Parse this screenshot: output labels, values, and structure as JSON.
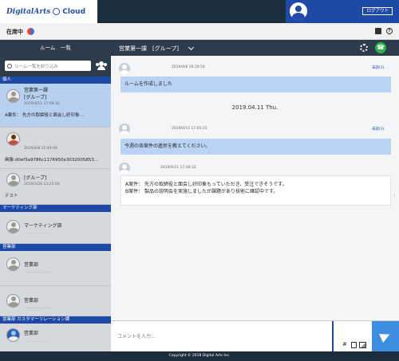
{
  "brand": {
    "name": "DigitalArts",
    "suffix": "Cloud"
  },
  "header": {
    "logout_label": "ログアウト"
  },
  "status": {
    "label": "在席中"
  },
  "sidebar": {
    "title": "ルーム　一覧",
    "search_placeholder": "ルーム一覧を絞り込み",
    "sections": [
      {
        "title": "個人"
      },
      {
        "title": "マーケティング部"
      },
      {
        "title": "営業部"
      },
      {
        "title": "営業部 カスタマーリレーション課"
      }
    ],
    "rooms": [
      {
        "name": "営業第一課",
        "name2": "[グループ]",
        "time": "2019/4/11 17:08:32",
        "preview": "A案件： 先方の取締役と面会し好印象…"
      },
      {
        "name": "",
        "time": "2019/4/8 15:49:09",
        "preview": "画像:d0ef3a9786c1176950e3032005853…"
      },
      {
        "name": "[グループ]",
        "time": "2019/3/26 13:25:06",
        "preview": "テスト"
      },
      {
        "name": "マーケティング部"
      },
      {
        "name": "営業部"
      },
      {
        "name": "営業部"
      },
      {
        "name": "営業部"
      }
    ]
  },
  "chat": {
    "title": "営業第一課　[グループ]",
    "messages": [
      {
        "time": "2019/4/8 16:19:54",
        "read": "未読(3)",
        "text": "ルームを作成しました"
      },
      {
        "time": "2019/4/11 17:05:21",
        "read": "未読(3)",
        "text": "今週の各案件の進捗を教えてください。"
      },
      {
        "time": "2019/4/11 17:08:32",
        "line1": "A案件： 先方の取締役と面会し好印象もっていただき、受注できそうです。",
        "line2": "B案件： 製品の説明会を実施しましたが課題があり技術に確認中です。"
      }
    ],
    "date_separator": "2019.04.11 Thu.",
    "input_placeholder": "コメントを入力...",
    "hash_label": "#"
  },
  "footer": {
    "copyright": "Copyright © 2018 Digital Arts Inc."
  },
  "colors": {
    "accent": "#1f49a6",
    "header_bg": "#1c2d3e",
    "bubble": "#b9d3f5",
    "call_button": "#2bb34a",
    "send_button": "#3d8de0"
  }
}
